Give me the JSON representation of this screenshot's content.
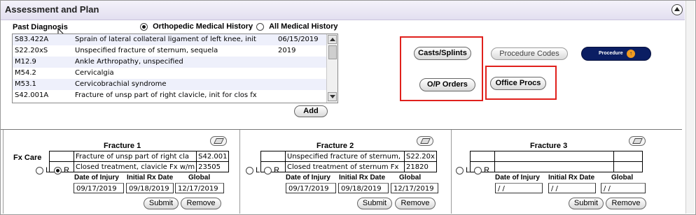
{
  "header": {
    "title": "Assessment and Plan"
  },
  "past_diagnosis": {
    "label": "Past Diagnosis",
    "filter_options": [
      {
        "label": "Orthopedic Medical History",
        "selected": true
      },
      {
        "label": "All Medical History",
        "selected": false
      }
    ],
    "rows": [
      {
        "code": "S83.422A",
        "desc": "Sprain of lateral collateral ligament of left knee, init",
        "date": "06/15/2019"
      },
      {
        "code": "S22.20xS",
        "desc": "Unspecified fracture of sternum, sequela",
        "date": "2019"
      },
      {
        "code": "M12.9",
        "desc": "Ankle Arthropathy, unspecified",
        "date": ""
      },
      {
        "code": "M54.2",
        "desc": "Cervicalgia",
        "date": ""
      },
      {
        "code": "M53.1",
        "desc": "Cervicobrachial syndrome",
        "date": ""
      },
      {
        "code": "S42.001A",
        "desc": "Fracture of unsp part of right clavicle, init for clos fx",
        "date": ""
      }
    ],
    "add_label": "Add"
  },
  "actions": {
    "casts": "Casts/Splints",
    "procedure_codes": "Procedure Codes",
    "procedure_logo": "Procedure",
    "op_orders": "O/P Orders",
    "office_procs": "Office Procs"
  },
  "accent": {
    "highlight_red": "#e0201c",
    "logo_navy": "#0b1e63",
    "logo_orange": "#f19a1f"
  },
  "fracture_common": {
    "fx_care_label": "Fx Care",
    "side_left": "L",
    "side_right": "R",
    "date_of_injury_label": "Date of Injury",
    "initial_rx_label": "Initial Rx Date",
    "global_label": "Global",
    "submit_label": "Submit",
    "remove_label": "Remove"
  },
  "fractures": [
    {
      "title": "Fracture 1",
      "diag": "Fracture of unsp part of right cla",
      "diag_code": "S42.001",
      "treatment": "Closed treatment, clavicle Fx w/m",
      "treatment_code": "23505",
      "date_of_injury": "09/17/2019",
      "initial_rx": "09/18/2019",
      "global": "12/17/2019"
    },
    {
      "title": "Fracture 2",
      "diag": "Unspecified fracture of sternum,",
      "diag_code": "S22.20x",
      "treatment": "Closed treatment of sternum Fx",
      "treatment_code": "21820",
      "date_of_injury": "09/17/2019",
      "initial_rx": "09/18/2019",
      "global": "12/17/2019"
    },
    {
      "title": "Fracture 3",
      "diag": "",
      "diag_code": "",
      "treatment": "",
      "treatment_code": "",
      "date_of_injury": " / /",
      "initial_rx": " / /",
      "global": " / /"
    }
  ]
}
